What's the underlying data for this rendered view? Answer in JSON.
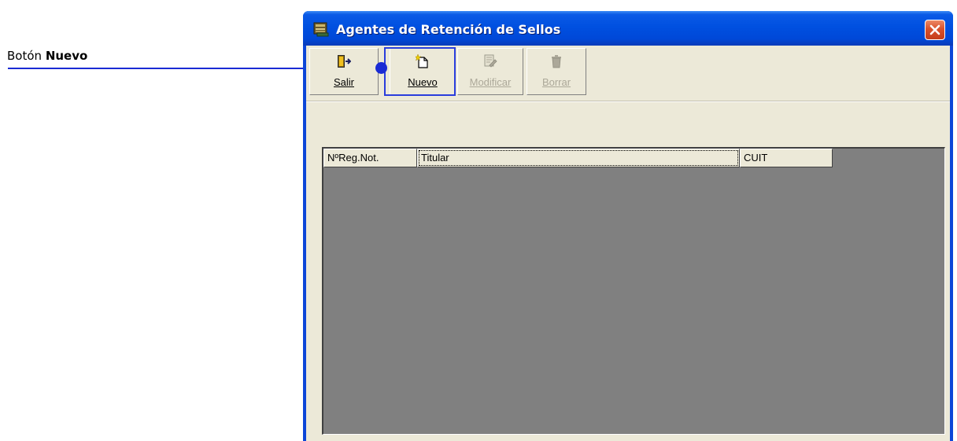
{
  "annotation": {
    "prefix": "Botón ",
    "target": "Nuevo",
    "color": "#1a2bd4"
  },
  "window": {
    "title": "Agentes de Retención de Sellos",
    "title_icon": "stamp-app-icon",
    "close_icon": "close-icon"
  },
  "toolbar": {
    "buttons": [
      {
        "label": "Salir",
        "icon": "exit-door-icon",
        "enabled": true
      },
      {
        "label": "Nuevo",
        "icon": "new-document-icon",
        "enabled": true
      },
      {
        "label": "Modificar",
        "icon": "edit-document-icon",
        "enabled": false
      },
      {
        "label": "Borrar",
        "icon": "trash-icon",
        "enabled": false
      }
    ]
  },
  "grid": {
    "columns": [
      "NºReg.Not.",
      "Titular",
      "CUIT"
    ],
    "rows": [],
    "background": "#808080"
  }
}
